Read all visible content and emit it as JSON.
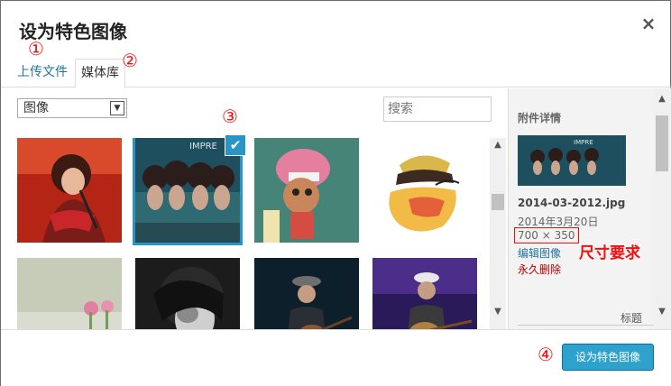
{
  "modal": {
    "title": "设为特色图像",
    "close": "×"
  },
  "tabs": [
    {
      "label": "上传文件"
    },
    {
      "label": "媒体库"
    }
  ],
  "toolbar": {
    "filter_value": "图像",
    "filter_arrow": "▼",
    "search_placeholder": "搜索"
  },
  "attachment": {
    "heading": "附件详情",
    "filename": "2014-03-2012.jpg",
    "date": "2014年3月20日",
    "dimensions": "700 × 350",
    "edit_link": "编辑图像",
    "delete_link": "永久删除",
    "title_label": "标题"
  },
  "annotations": {
    "n1": "①",
    "n2": "②",
    "n3": "③",
    "n4": "④",
    "size_note": "尺寸要求"
  },
  "footer": {
    "button": "设为特色图像"
  },
  "icons": {
    "check": "✔",
    "up": "▲",
    "down": "▼"
  }
}
